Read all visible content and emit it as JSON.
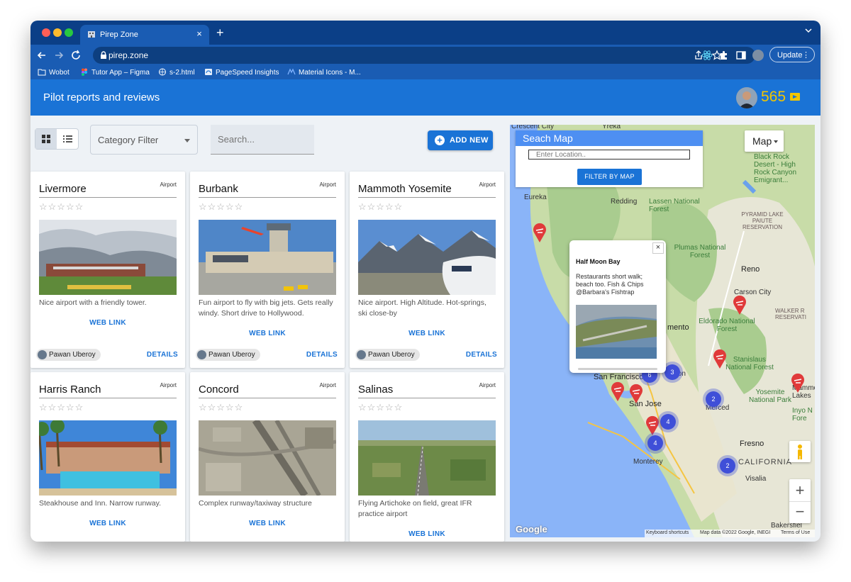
{
  "browser": {
    "tab_title": "Pirep Zone",
    "tab_close": "×",
    "new_tab": "+",
    "url": "pirep.zone",
    "update_label": "Update",
    "bookmarks": [
      {
        "label": "Wobot",
        "icon": "folder-icon"
      },
      {
        "label": "Tutor App – Figma",
        "icon": "figma-icon"
      },
      {
        "label": "s-2.html",
        "icon": "globe-icon"
      },
      {
        "label": "PageSpeed Insights",
        "icon": "pagespeed-icon"
      },
      {
        "label": "Material Icons - M...",
        "icon": "material-icon"
      }
    ]
  },
  "app": {
    "title": "Pilot reports and reviews",
    "points": "565"
  },
  "controls": {
    "category_filter": "Category Filter",
    "search_placeholder": "Search...",
    "add_new": "ADD NEW"
  },
  "cards": [
    {
      "name": "Livermore",
      "type": "Airport",
      "rating": 0,
      "description": "Nice airport with a friendly tower.",
      "web_link": "WEB LINK",
      "user": "Pawan Uberoy",
      "details": "DETAILS"
    },
    {
      "name": "Burbank",
      "type": "Airport",
      "rating": 0,
      "description": "Fun airport to fly with big jets. Gets really windy. Short drive to Hollywood.",
      "web_link": "WEB LINK",
      "user": "Pawan Uberoy",
      "details": "DETAILS"
    },
    {
      "name": "Mammoth Yosemite",
      "type": "Airport",
      "rating": 0,
      "description": "Nice airport. High Altitude. Hot-springs, ski close-by",
      "web_link": "WEB LINK",
      "user": "Pawan Uberoy",
      "details": "DETAILS"
    },
    {
      "name": "Harris Ranch",
      "type": "Airport",
      "rating": 0,
      "description": "Steakhouse and Inn. Narrow runway.",
      "web_link": "WEB LINK"
    },
    {
      "name": "Concord",
      "type": "Airport",
      "rating": 0,
      "description": "Complex runway/taxiway structure",
      "web_link": "WEB LINK"
    },
    {
      "name": "Salinas",
      "type": "Airport",
      "rating": 0,
      "description": "Flying Artichoke on field, great IFR practice airport",
      "web_link": "WEB LINK"
    }
  ],
  "stars": "☆☆☆☆☆",
  "map": {
    "search_title": "Seach Map",
    "location_placeholder": "Enter Location..",
    "filter_button": "FILTER BY MAP",
    "map_type": "Map",
    "info_window": {
      "title": "Half Moon Bay",
      "description": "Restaurants short walk; beach too. Fish & Chips @Barbara's Fishtrap",
      "close": "×"
    },
    "zoom_in": "+",
    "zoom_out": "−",
    "google": "Google",
    "keyboard_shortcuts": "Keyboard shortcuts",
    "map_data": "Map data ©2022 Google, INEGI",
    "terms": "Terms of Use",
    "labels": {
      "crescent_city": "Crescent City",
      "yreka": "Yreka",
      "eureka": "Eureka",
      "redding": "Redding",
      "lassen": "Lassen National Forest",
      "black_rock": "Black Rock Desert - High Rock Canyon Emigrant...",
      "pyramid_lake": "PYRAMID LAKE PAIUTE RESERVATION",
      "plumas": "Plumas National Forest",
      "reno": "Reno",
      "carson_city": "Carson City",
      "eldorado": "Eldorado National Forest",
      "walker_river": "WALKER R RESERVATI",
      "sacramento": "mento",
      "stanislaus": "Stanislaus National Forest",
      "stockton": "ckton",
      "yosemite": "Yosemite National Park",
      "mammoth_lakes": "Mammoth Lakes",
      "san_francisco": "San Francisco",
      "san_jose": "San Jose",
      "merced": "Merced",
      "inyo": "Inyo N Fore",
      "fresno": "Fresno",
      "monterey": "Monterey",
      "california": "CALIFORNIA",
      "visalia": "Visalia",
      "bakersfield": "Bakersfiel"
    },
    "clusters": [
      "6",
      "3",
      "2",
      "4",
      "4",
      "2"
    ]
  },
  "colors": {
    "tab_strip": "#0b3f87",
    "toolbar": "#1a5cb3",
    "app_bar": "#1a73d6",
    "accent": "#1a73d6",
    "points": "#f2c500",
    "cluster": "#3f4fd8",
    "pin": "#e03a3a"
  }
}
